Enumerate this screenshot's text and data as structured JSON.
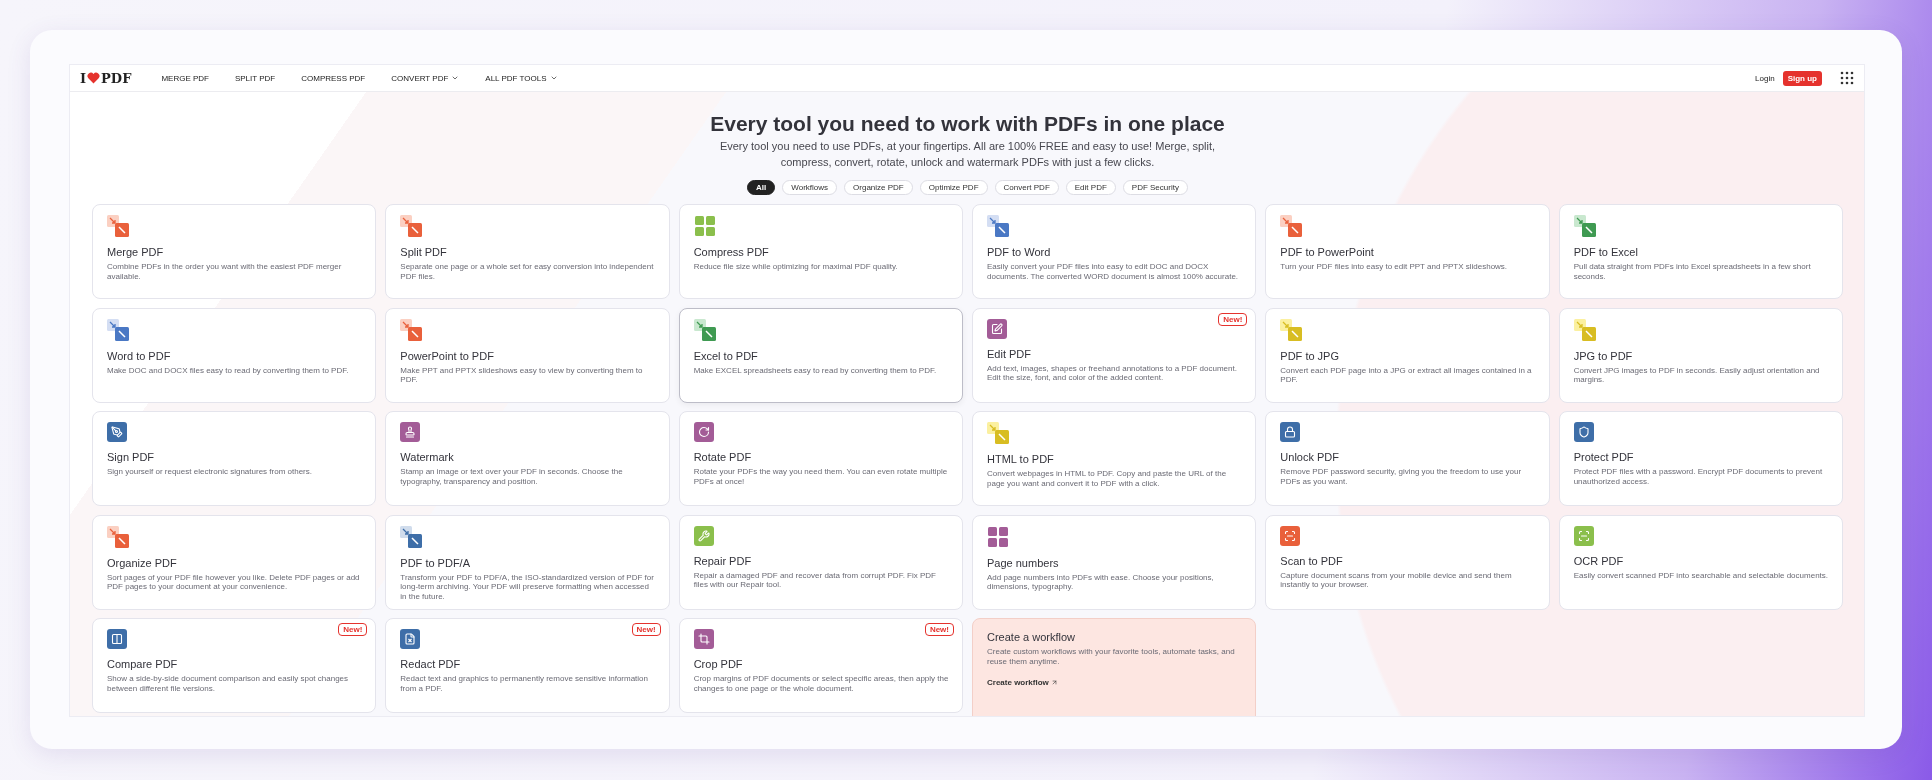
{
  "nav": {
    "logo": {
      "left": "I",
      "right": "PDF"
    },
    "links": [
      {
        "label": "MERGE PDF",
        "dropdown": false
      },
      {
        "label": "SPLIT PDF",
        "dropdown": false
      },
      {
        "label": "COMPRESS PDF",
        "dropdown": false
      },
      {
        "label": "CONVERT PDF",
        "dropdown": true
      },
      {
        "label": "ALL PDF TOOLS",
        "dropdown": true
      }
    ],
    "login": "Login",
    "signup": "Sign up"
  },
  "hero": {
    "title": "Every tool you need to work with PDFs in one place",
    "subtitle": "Every tool you need to use PDFs, at your fingertips. All are 100% FREE and easy to use! Merge, split, compress, convert, rotate, unlock and watermark PDFs with just a few clicks."
  },
  "filters": [
    {
      "label": "All",
      "selected": true
    },
    {
      "label": "Workflows",
      "selected": false
    },
    {
      "label": "Organize PDF",
      "selected": false
    },
    {
      "label": "Optimize PDF",
      "selected": false
    },
    {
      "label": "Convert PDF",
      "selected": false
    },
    {
      "label": "Edit PDF",
      "selected": false
    },
    {
      "label": "PDF Security",
      "selected": false
    }
  ],
  "tools": [
    {
      "title": "Merge PDF",
      "description": "Combine PDFs in the order you want with the easiest PDF merger available.",
      "hovered": false
    },
    {
      "title": "Split PDF",
      "description": "Separate one page or a whole set for easy conversion into independent PDF files.",
      "hovered": false
    },
    {
      "title": "Compress PDF",
      "description": "Reduce file size while optimizing for maximal PDF quality.",
      "hovered": false
    },
    {
      "title": "PDF to Word",
      "description": "Easily convert your PDF files into easy to edit DOC and DOCX documents. The converted WORD document is almost 100% accurate.",
      "hovered": false
    },
    {
      "title": "PDF to PowerPoint",
      "description": "Turn your PDF files into easy to edit PPT and PPTX slideshows.",
      "hovered": false
    },
    {
      "title": "PDF to Excel",
      "description": "Pull data straight from PDFs into Excel spreadsheets in a few short seconds.",
      "hovered": false
    },
    {
      "title": "Word to PDF",
      "description": "Make DOC and DOCX files easy to read by converting them to PDF.",
      "hovered": false
    },
    {
      "title": "PowerPoint to PDF",
      "description": "Make PPT and PPTX slideshows easy to view by converting them to PDF.",
      "hovered": false
    },
    {
      "title": "Excel to PDF",
      "description": "Make EXCEL spreadsheets easy to read by converting them to PDF.",
      "hovered": true
    },
    {
      "title": "Edit PDF",
      "description": "Add text, images, shapes or freehand annotations to a PDF document. Edit the size, font, and color of the added content.",
      "badge": "New!",
      "hovered": false
    },
    {
      "title": "PDF to JPG",
      "description": "Convert each PDF page into a JPG or extract all images contained in a PDF.",
      "hovered": false
    },
    {
      "title": "JPG to PDF",
      "description": "Convert JPG images to PDF in seconds. Easily adjust orientation and margins.",
      "hovered": false
    },
    {
      "title": "Sign PDF",
      "description": "Sign yourself or request electronic signatures from others.",
      "hovered": false
    },
    {
      "title": "Watermark",
      "description": "Stamp an image or text over your PDF in seconds. Choose the typography, transparency and position.",
      "hovered": false
    },
    {
      "title": "Rotate PDF",
      "description": "Rotate your PDFs the way you need them. You can even rotate multiple PDFs at once!",
      "hovered": false
    },
    {
      "title": "HTML to PDF",
      "description": "Convert webpages in HTML to PDF. Copy and paste the URL of the page you want and convert it to PDF with a click.",
      "hovered": false
    },
    {
      "title": "Unlock PDF",
      "description": "Remove PDF password security, giving you the freedom to use your PDFs as you want.",
      "hovered": false
    },
    {
      "title": "Protect PDF",
      "description": "Protect PDF files with a password. Encrypt PDF documents to prevent unauthorized access.",
      "hovered": false
    },
    {
      "title": "Organize PDF",
      "description": "Sort pages of your PDF file however you like. Delete PDF pages or add PDF pages to your document at your convenience.",
      "hovered": false
    },
    {
      "title": "PDF to PDF/A",
      "description": "Transform your PDF to PDF/A, the ISO-standardized version of PDF for long-term archiving. Your PDF will preserve formatting when accessed in the future.",
      "hovered": false
    },
    {
      "title": "Repair PDF",
      "description": "Repair a damaged PDF and recover data from corrupt PDF. Fix PDF files with our Repair tool.",
      "hovered": false
    },
    {
      "title": "Page numbers",
      "description": "Add page numbers into PDFs with ease. Choose your positions, dimensions, typography.",
      "hovered": false
    },
    {
      "title": "Scan to PDF",
      "description": "Capture document scans from your mobile device and send them instantly to your browser.",
      "hovered": false
    },
    {
      "title": "OCR PDF",
      "description": "Easily convert scanned PDF into searchable and selectable documents.",
      "hovered": false
    },
    {
      "title": "Compare PDF",
      "description": "Show a side-by-side document comparison and easily spot changes between different file versions.",
      "badge": "New!",
      "hovered": false
    },
    {
      "title": "Redact PDF",
      "description": "Redact text and graphics to permanently remove sensitive information from a PDF.",
      "badge": "New!",
      "hovered": false
    },
    {
      "title": "Crop PDF",
      "description": "Crop margins of PDF documents or select specific areas, then apply the changes to one page or the whole document.",
      "badge": "New!",
      "hovered": false
    }
  ],
  "workflow": {
    "title": "Create a workflow",
    "description": "Create custom workflows with your favorite tools, automate tasks, and reuse them anytime.",
    "link": "Create workflow"
  }
}
